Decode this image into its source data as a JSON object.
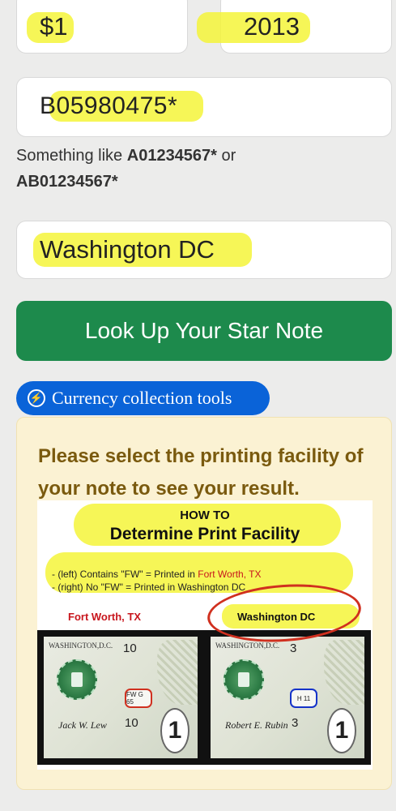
{
  "form": {
    "denomination": "$1",
    "series_year": "2013",
    "serial_number": "B05980475*",
    "hint_prefix": "Something like ",
    "hint_example_1": "A01234567*",
    "hint_or": " or",
    "hint_example_2": "AB01234567*",
    "facility": "Washington DC",
    "lookup_button": "Look Up Your Star Note"
  },
  "tools_button": {
    "label": "Currency collection tools",
    "icon": "bolt-circle-icon"
  },
  "result_panel": {
    "message": "Please select the printing facility of your note to see your result."
  },
  "infographic": {
    "howto": "HOW TO",
    "title": "Determine Print Facility",
    "rule_left_prefix": "- (left) Contains \"FW\" = Printed in ",
    "rule_left_place": "Fort Worth, TX",
    "rule_right": "- (right) No \"FW\" = Printed in Washington DC",
    "left_label": "Fort Worth, TX",
    "right_label": "Washington DC",
    "left_bill": {
      "city": "WASHINGTON,D.C.",
      "plate": "10",
      "facemark": "FW G 65",
      "plate2": "10",
      "sig": "Jack W. Lew"
    },
    "right_bill": {
      "city": "WASHINGTON,D.C.",
      "plate": "3",
      "facemark": "H 11",
      "plate2": "3",
      "sig": "Robert E. Rubin"
    },
    "denomination_digit": "1"
  },
  "colors": {
    "green_button": "#1d8a4c",
    "blue_button": "#0a63d8",
    "panel_bg": "#fbf2d3",
    "panel_text": "#7a5a0e",
    "highlight": "#f5f53a",
    "red_mark": "#d0301f"
  }
}
